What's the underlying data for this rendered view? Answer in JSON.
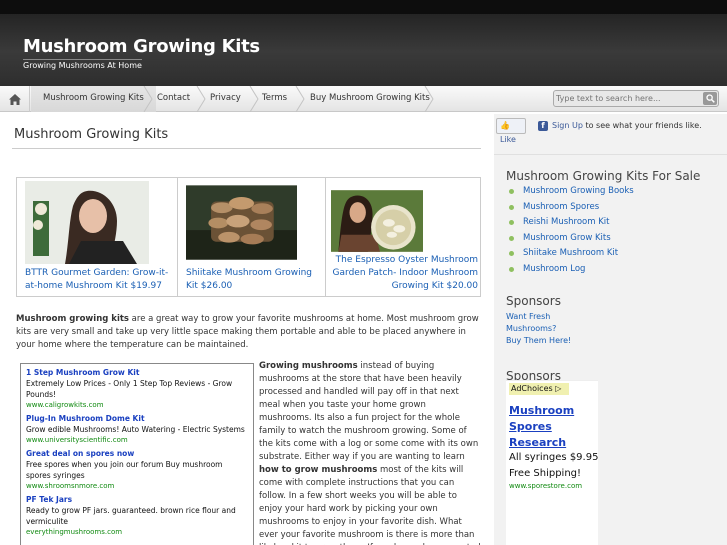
{
  "header": {
    "site_title": "Mushroom Growing Kits",
    "tagline": "Growing Mushrooms At Home"
  },
  "nav": {
    "home_icon": "home-icon",
    "items": [
      {
        "label": "Mushroom Growing Kits"
      },
      {
        "label": "Contact"
      },
      {
        "label": "Privacy"
      },
      {
        "label": "Terms"
      },
      {
        "label": "Buy Mushroom Growing Kits"
      }
    ],
    "search_placeholder": "Type text to search here..."
  },
  "main": {
    "page_title": "Mushroom Growing Kits",
    "products": [
      {
        "caption": "BTTR Gourmet Garden: Grow-it-at-home Mushroom Kit $19.97"
      },
      {
        "caption": "Shiitake Mushroom Growing Kit $26.00"
      },
      {
        "caption": "The Espresso Oyster Mushroom Garden Patch- Indoor Mushroom Growing Kit $20.00"
      }
    ],
    "intro_bold": "Mushroom growing kits",
    "intro_rest": " are a great way to grow your favorite mushrooms at home.  Most mushroom grow kits are very small and take up very little space making them portable and able to be placed anywhere in your home where the temperature can be maintained.",
    "body_bold1": "Growing mushrooms",
    "body_text1": " instead of buying mushrooms at the store that have been heavily processed and handled will pay off in that next meal when you taste your home grown mushrooms.  Its also a fun project for the whole family to watch the mushroom growing.  Some of the kits come with a log or some come with its own substrate.  Either way if you are wanting to learn ",
    "body_bold2": "how to grow mushrooms",
    "body_text2": " most of the kits will come with complete instructions that you can follow.  In a few short weeks you will be able to enjoy your hard work by picking your own mushrooms to enjoy in your favorite dish.  What ever your favorite mushroom is there is more than likely a kit to grow them.   If you have always wanted to grow"
  },
  "ads": [
    {
      "title": "1 Step Mushroom Grow Kit",
      "desc": "Extremely Low Prices - Only 1 Step Top Reviews - Grow Pounds!",
      "url": "www.caligrowkits.com"
    },
    {
      "title": "Plug-In Mushroom Dome Kit",
      "desc": "Grow edible Mushrooms! Auto Watering - Electric Systems",
      "url": "www.universityscientific.com"
    },
    {
      "title": "Great deal on spores now",
      "desc": "Free spores when you join our forum Buy mushroom spores syringes",
      "url": "www.shroomsnmore.com"
    },
    {
      "title": "PF Tek Jars",
      "desc": "Ready to grow PF jars. guaranteed. brown rice flour and vermiculite",
      "url": "everythingmushrooms.com"
    }
  ],
  "sidebar": {
    "fb_like": "Like",
    "fb_signup": "Sign Up",
    "fb_text": " to see what your friends like.",
    "forsale_heading": "Mushroom Growing Kits For Sale",
    "forsale_items": [
      "Mushroom Growing Books",
      "Mushroom Spores",
      "Reishi Mushroom Kit",
      "Mushroom Grow Kits",
      "Shiitake Mushroom Kit",
      "Mushroom Log"
    ],
    "sponsors_heading": "Sponsors",
    "sponsor_links": [
      "Want Fresh",
      "Mushrooms?",
      "Buy Them Here!"
    ],
    "sponsors_heading2": "Sponsors",
    "adchoices": "AdChoices ▷",
    "sponsor_ad": {
      "title": "Mushroom Spores Research",
      "desc": "All syringes $9.95 Free Shipping!",
      "url": "www.sporestore.com"
    }
  }
}
